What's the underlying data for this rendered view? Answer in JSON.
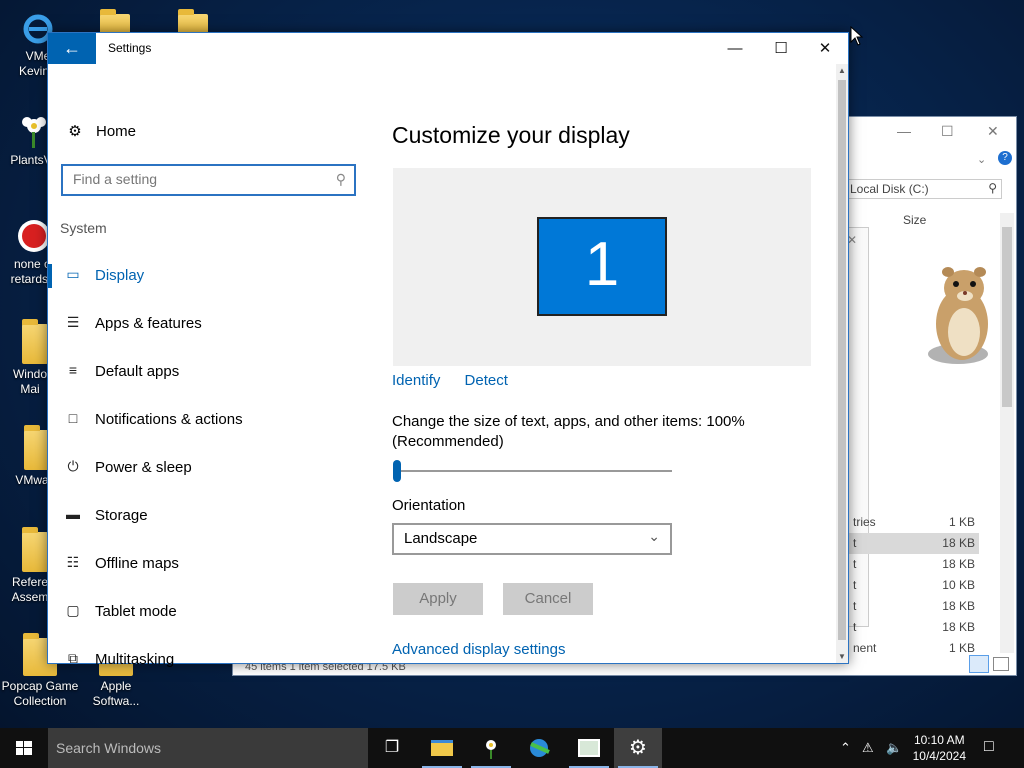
{
  "desktop": {
    "icons": [
      {
        "label1": "VMe",
        "label2": "KevinS"
      },
      {
        "label1": "PlantsVs",
        "label2": ""
      },
      {
        "label1": "none of",
        "label2": "retards k"
      },
      {
        "label1": "Windo",
        "label2": "Mai"
      },
      {
        "label1": "VMwa",
        "label2": ""
      },
      {
        "label1": "Refere",
        "label2": "Assem"
      },
      {
        "label1": "Popcap Game",
        "label2": "Collection"
      },
      {
        "label1": "Apple",
        "label2": "Softwa..."
      }
    ]
  },
  "explorer": {
    "search_placeholder": "Local Disk (C:)",
    "column_size": "Size",
    "rows": [
      {
        "name": "tries",
        "size": "1 KB",
        "selected": false
      },
      {
        "name": "t",
        "size": "18 KB",
        "selected": true
      },
      {
        "name": "t",
        "size": "18 KB",
        "selected": false
      },
      {
        "name": "t",
        "size": "10 KB",
        "selected": false
      },
      {
        "name": "t",
        "size": "18 KB",
        "selected": false
      },
      {
        "name": "t",
        "size": "18 KB",
        "selected": false
      },
      {
        "name": "nent",
        "size": "1 KB",
        "selected": false
      }
    ],
    "status": "45 items     1 item selected  17.5 KB"
  },
  "settings": {
    "window_title": "Settings",
    "nav": {
      "home": "Home",
      "search_placeholder": "Find a setting",
      "section": "System",
      "items": [
        {
          "label": "Display",
          "icon": "monitor-icon",
          "active": true
        },
        {
          "label": "Apps & features",
          "icon": "list-icon",
          "active": false
        },
        {
          "label": "Default apps",
          "icon": "default-apps-icon",
          "active": false
        },
        {
          "label": "Notifications & actions",
          "icon": "notification-icon",
          "active": false
        },
        {
          "label": "Power & sleep",
          "icon": "power-icon",
          "active": false
        },
        {
          "label": "Storage",
          "icon": "storage-icon",
          "active": false
        },
        {
          "label": "Offline maps",
          "icon": "map-icon",
          "active": false
        },
        {
          "label": "Tablet mode",
          "icon": "tablet-icon",
          "active": false
        },
        {
          "label": "Multitasking",
          "icon": "multitasking-icon",
          "active": false
        }
      ]
    },
    "content": {
      "title": "Customize your display",
      "monitor_number": "1",
      "identify": "Identify",
      "detect": "Detect",
      "scale_label_1": "Change the size of text, apps, and other items: 100%",
      "scale_label_2": "(Recommended)",
      "scale_value": 0,
      "orientation_label": "Orientation",
      "orientation_value": "Landscape",
      "apply": "Apply",
      "cancel": "Cancel",
      "advanced": "Advanced display settings"
    }
  },
  "taskbar": {
    "search_placeholder": "Search Windows",
    "time": "10:10 AM",
    "date": "10/4/2024"
  },
  "colors": {
    "accent": "#0063b1",
    "monitor": "#0078d7",
    "taskbar": "#101010"
  }
}
